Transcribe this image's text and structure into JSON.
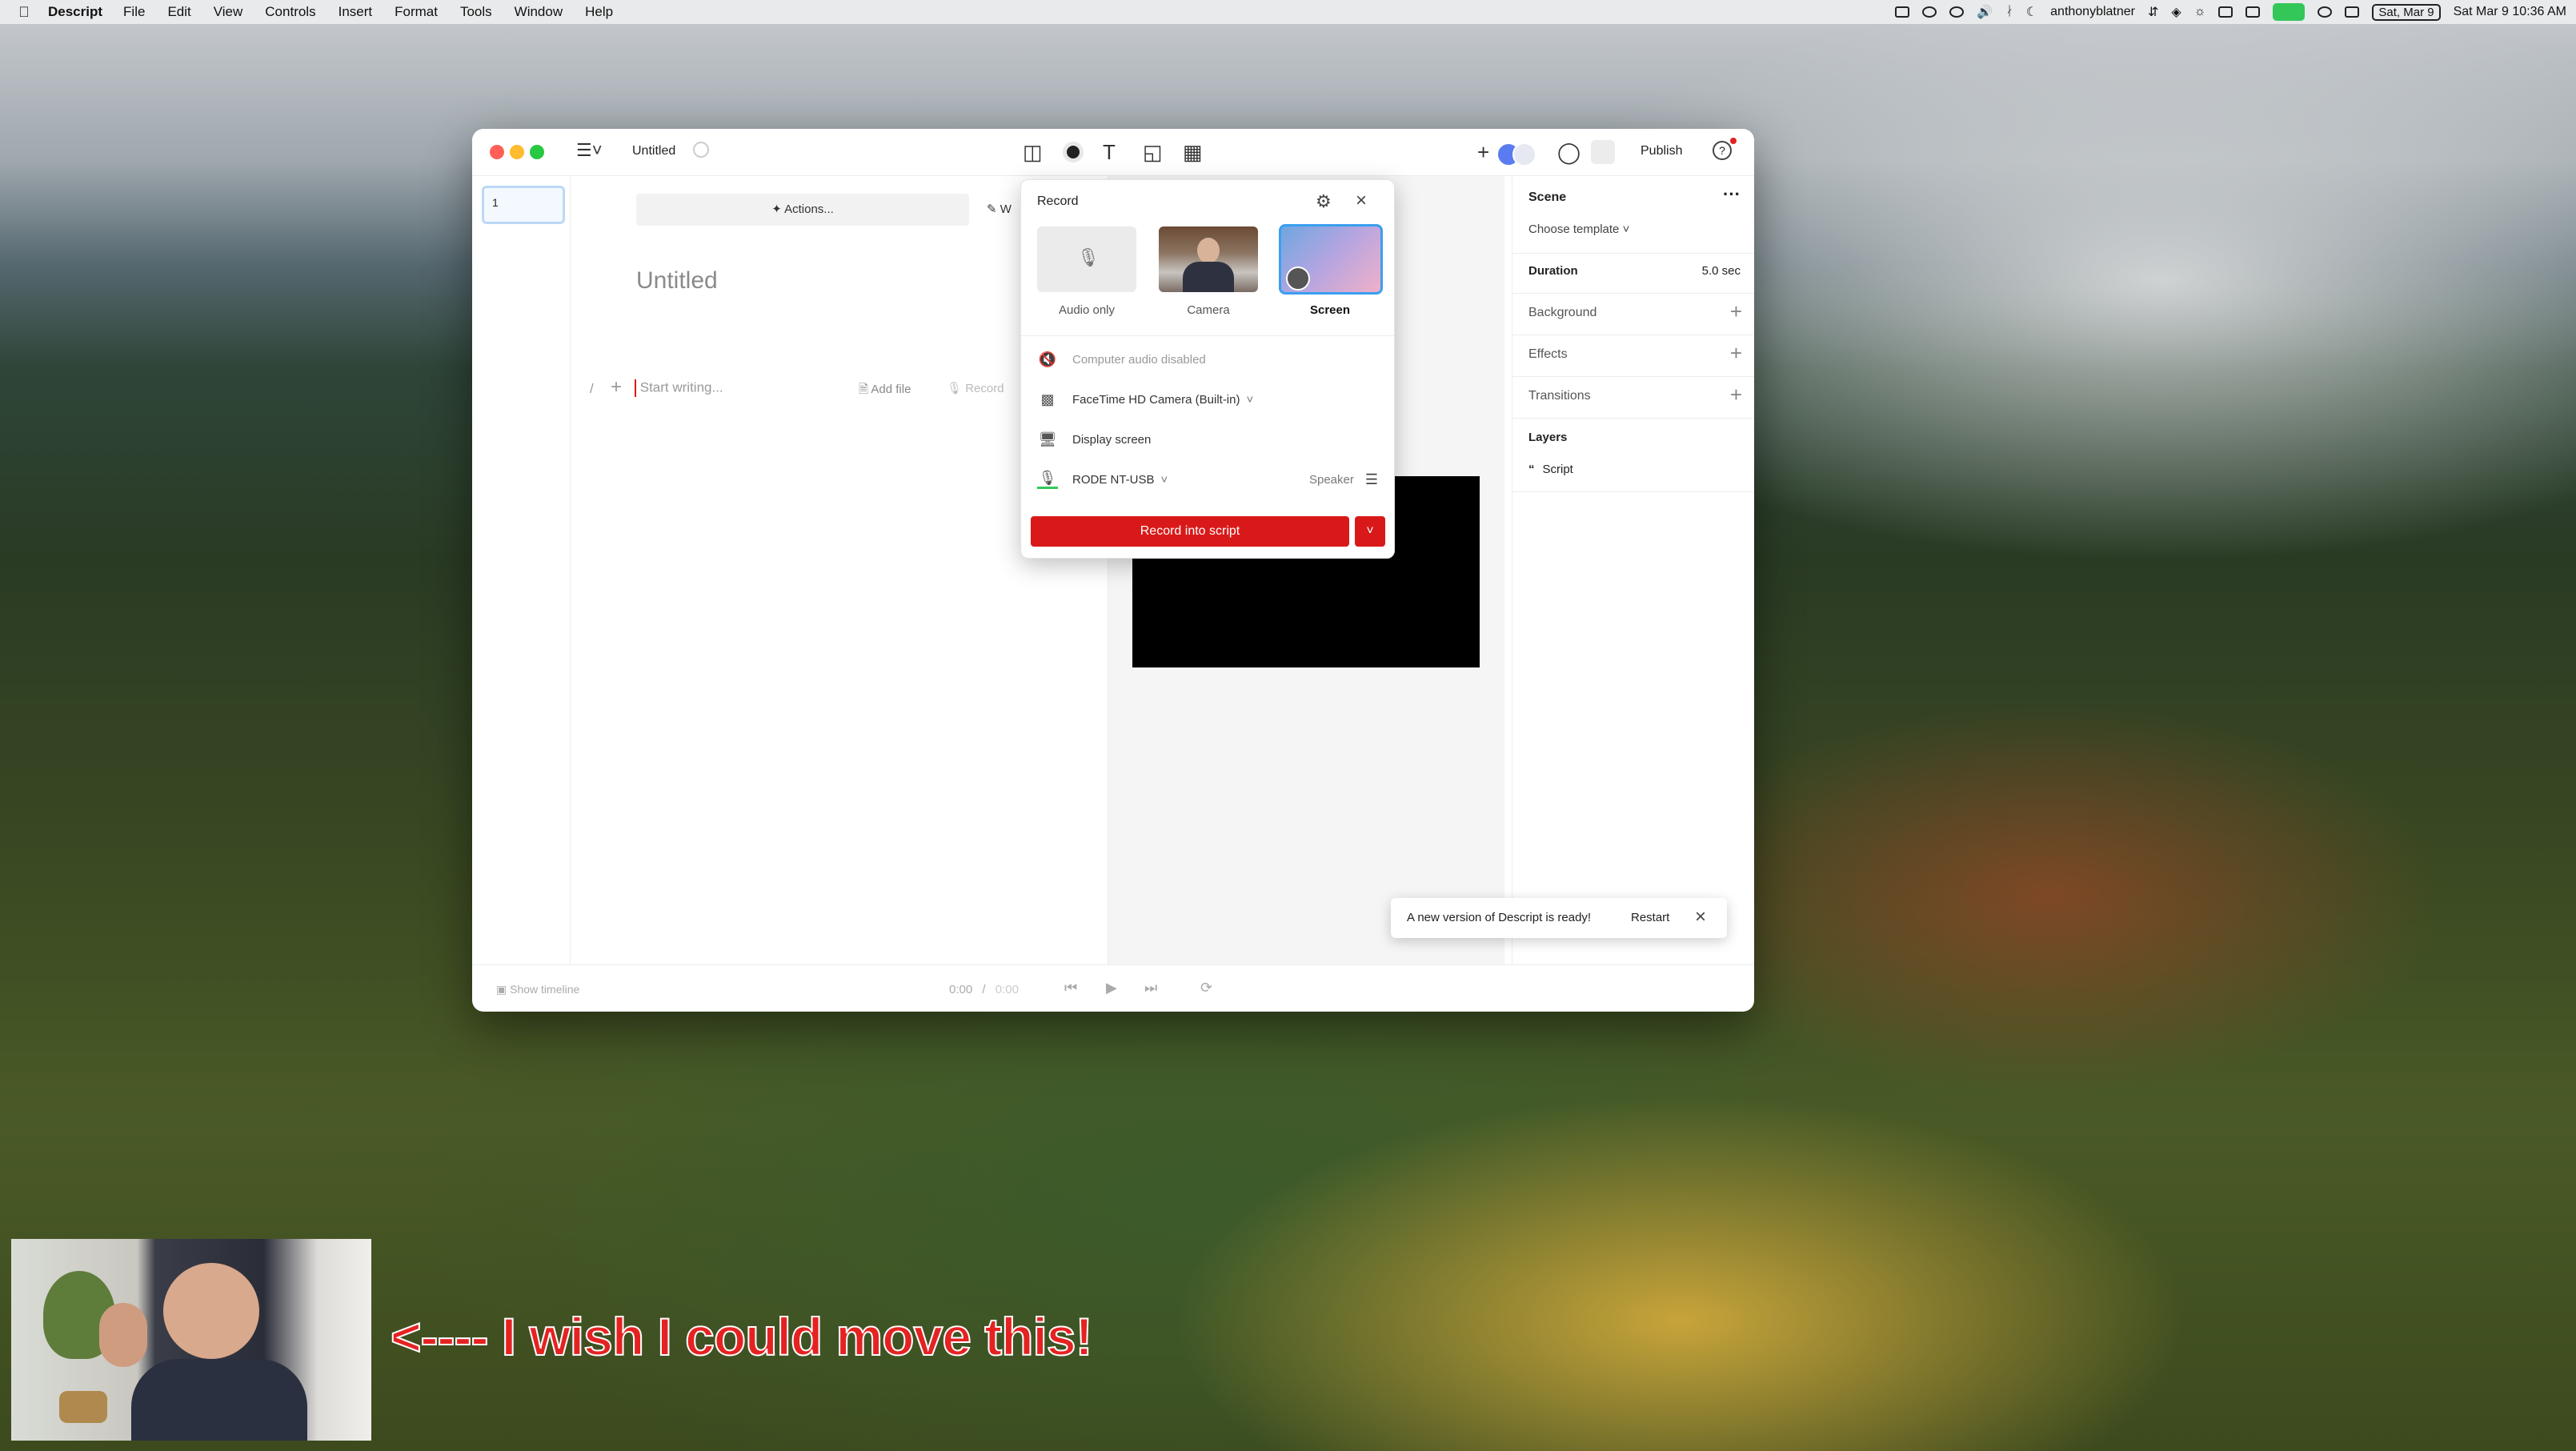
{
  "menubar": {
    "app_name": "Descript",
    "items": [
      "File",
      "Edit",
      "View",
      "Controls",
      "Insert",
      "Format",
      "Tools",
      "Window",
      "Help"
    ],
    "username": "anthonyblatner",
    "date_badge": "Sat, Mar 9",
    "datetime": "Sat Mar 9  10:36 AM"
  },
  "window": {
    "title": "Untitled",
    "publish_label": "Publish",
    "scene_number": "1"
  },
  "editor": {
    "actions_label": "Actions...",
    "write_label": "W",
    "doc_title": "Untitled",
    "slash": "/",
    "placeholder": "Start writing...",
    "add_file_label": "Add file",
    "record_label": "Record"
  },
  "record_popup": {
    "title": "Record",
    "options": [
      {
        "label": "Audio only",
        "selected": false
      },
      {
        "label": "Camera",
        "selected": false
      },
      {
        "label": "Screen",
        "selected": true
      }
    ],
    "computer_audio": "Computer audio disabled",
    "camera_device": "FaceTime HD Camera (Built-in)",
    "display": "Display screen",
    "mic_device": "RODE NT-USB",
    "speaker_label": "Speaker",
    "record_button": "Record into script",
    "accent": "#d91919"
  },
  "right_panel": {
    "scene_title": "Scene",
    "choose_template": "Choose template",
    "duration_label": "Duration",
    "duration_value": "5.0 sec",
    "background_label": "Background",
    "effects_label": "Effects",
    "transitions_label": "Transitions",
    "layers_title": "Layers",
    "layer_script": "Script"
  },
  "toast": {
    "message": "A new version of Descript is ready!",
    "restart_label": "Restart"
  },
  "bottom_bar": {
    "show_timeline": "Show timeline",
    "current_time": "0:00",
    "divider": "/",
    "total_time": "0:00"
  },
  "overlay": {
    "caption": "<---- I wish I could move this!"
  }
}
